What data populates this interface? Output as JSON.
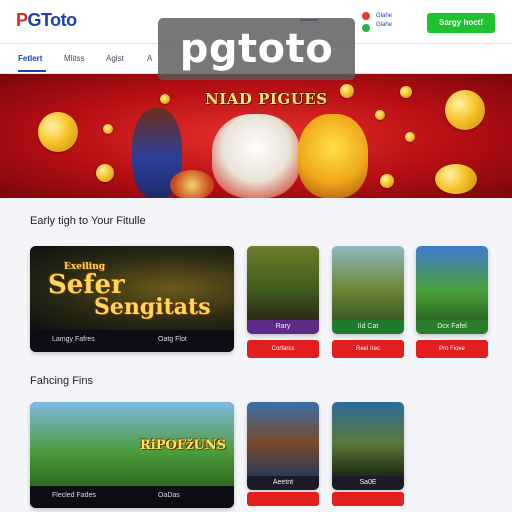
{
  "header": {
    "logo_p": "P",
    "logo_rest": "GToto",
    "user_line1": "Glahe",
    "user_line2": "Glahe",
    "signin_label": "Sargy hoctf"
  },
  "nav": {
    "items": [
      {
        "label": "Fetlert"
      },
      {
        "label": "Mlitss"
      },
      {
        "label": "Aglst"
      },
      {
        "label": "A"
      }
    ]
  },
  "watermark": "pgtoto",
  "banner": {
    "title": "NIAD PIGUES"
  },
  "section1": {
    "title": "Early tigh to Your Fitulle",
    "featured": {
      "small_title": "Exeiling",
      "title_line1": "Sefer",
      "title_line2": "Sengitats",
      "left_label": "Lamgy Fafres",
      "right_label": "Oatg Flot"
    },
    "cards": [
      {
        "label": "Rary",
        "button": "Corfarcs"
      },
      {
        "label": "Iíd Cat",
        "button": "Reel Irec"
      },
      {
        "label": "Dcx Fafel",
        "button": "Pro Fiove"
      }
    ]
  },
  "section2": {
    "title": "Fahcing Fins",
    "featured": {
      "title": "RiPOFžUNS",
      "left_label": "Flecled Fades",
      "right_label": "OaDas"
    },
    "cards": [
      {
        "label": "Aeetnt"
      },
      {
        "label": "Sa0E"
      }
    ]
  },
  "colors": {
    "brand_red": "#e32626",
    "brand_blue": "#1f3fb0",
    "cta_green": "#1ec22d",
    "play_red": "#e21e1e"
  }
}
